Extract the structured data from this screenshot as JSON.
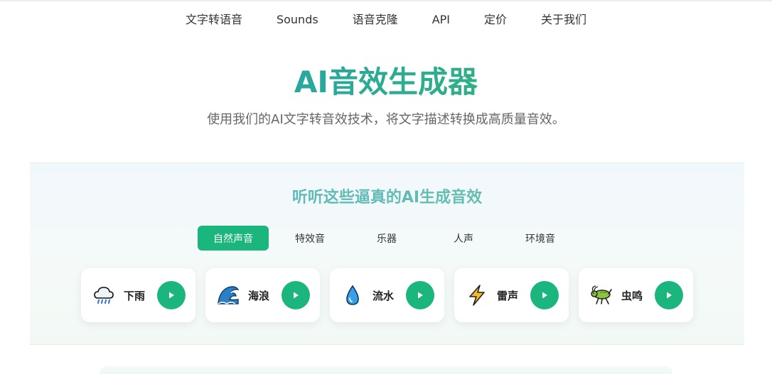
{
  "nav": {
    "items": [
      "文字转语音",
      "Sounds",
      "语音克隆",
      "API",
      "定价",
      "关于我们"
    ]
  },
  "hero": {
    "title": "AI音效生成器",
    "subtitle": "使用我们的AI文字转音效技术，将文字描述转换成高质量音效。"
  },
  "demo": {
    "title": "听听这些逼真的AI生成音效",
    "tabs": [
      {
        "label": "自然声音",
        "active": true
      },
      {
        "label": "特效音",
        "active": false
      },
      {
        "label": "乐器",
        "active": false
      },
      {
        "label": "人声",
        "active": false
      },
      {
        "label": "环境音",
        "active": false
      }
    ],
    "sounds": [
      {
        "label": "下雨",
        "icon": "rain-cloud-icon"
      },
      {
        "label": "海浪",
        "icon": "wave-icon"
      },
      {
        "label": "流水",
        "icon": "water-drop-icon"
      },
      {
        "label": "雷声",
        "icon": "lightning-icon"
      },
      {
        "label": "虫鸣",
        "icon": "cricket-icon"
      }
    ]
  },
  "colors": {
    "accent": "#1bb57e",
    "title_gradient_start": "#1e9bc8",
    "title_gradient_end": "#3bb27a"
  }
}
